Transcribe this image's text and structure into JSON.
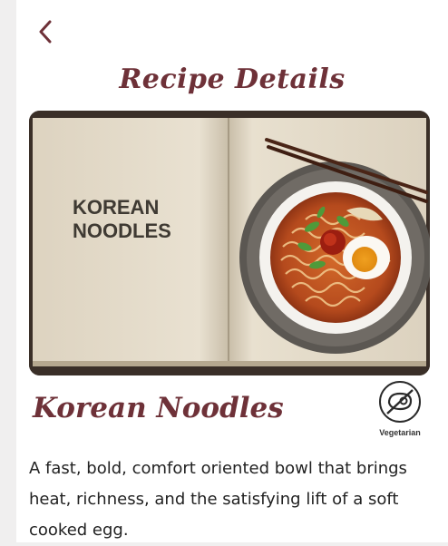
{
  "header": {
    "back_icon": "chevron-left-icon",
    "title": "Recipe Details"
  },
  "hero": {
    "book_text_line1": "KOREAN",
    "book_text_line2": "NOODLES"
  },
  "recipe": {
    "name": "Korean Noodles",
    "diet_icon": "no-meat-icon",
    "diet_label": "Vegetarian",
    "description": "A fast, bold, comfort oriented bowl that brings heat, richness, and the satisfying lift of a soft cooked egg."
  },
  "colors": {
    "accent": "#6e3138",
    "text": "#222222",
    "background": "#ffffff"
  }
}
